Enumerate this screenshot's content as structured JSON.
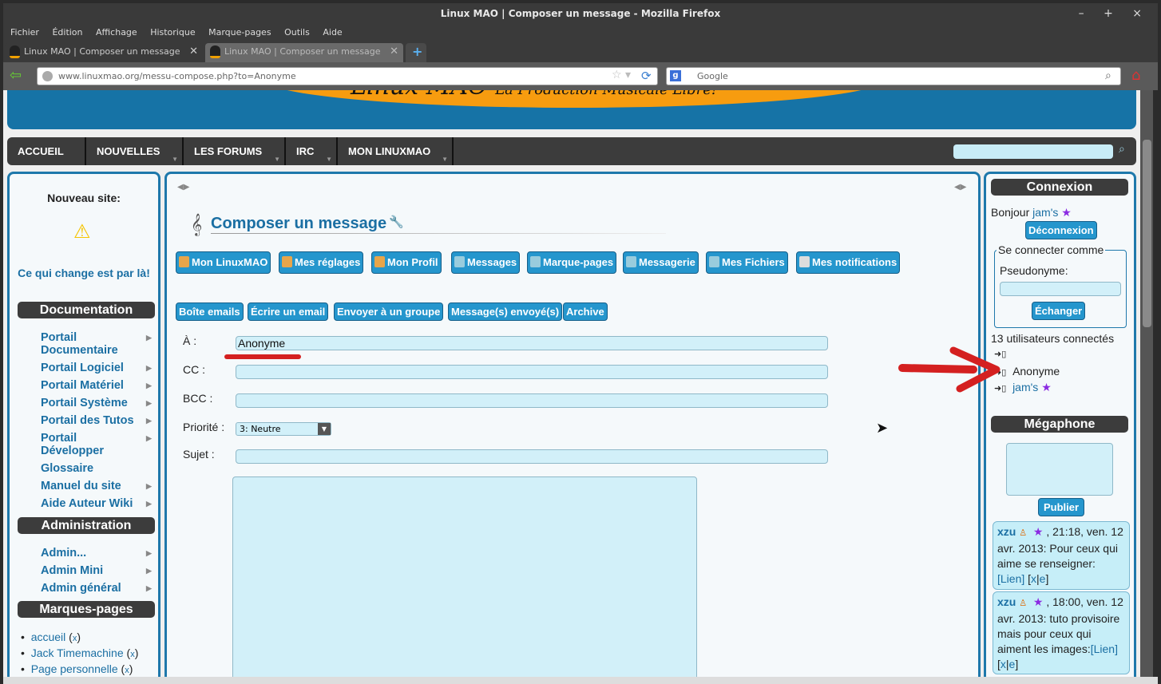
{
  "window": {
    "title": "Linux MAO | Composer un message - Mozilla Firefox",
    "controls": "– + ×"
  },
  "menubar": [
    "Fichier",
    "Édition",
    "Affichage",
    "Historique",
    "Marque-pages",
    "Outils",
    "Aide"
  ],
  "tabs": [
    {
      "label": "Linux MAO | Composer un message"
    },
    {
      "label": "Linux MAO | Composer un message"
    }
  ],
  "new_tab": "+",
  "address": {
    "url": "www.linuxmao.org/messu-compose.php?to=Anonyme"
  },
  "search": {
    "placeholder": "Google"
  },
  "site": {
    "logo": "Linux MAO",
    "tagline": "La Production Musicale Libre!",
    "menu": [
      "ACCUEIL",
      "NOUVELLES",
      "LES FORUMS",
      "IRC",
      "MON LINUXMAO"
    ]
  },
  "left": {
    "new_site": "Nouveau site:",
    "new_site_link": "Ce qui change est par là!",
    "doc_title": "Documentation",
    "doc_items": [
      "Portail Documentaire",
      "Portail Logiciel",
      "Portail Matériel",
      "Portail Système",
      "Portail des Tutos",
      "Portail Développer",
      "Glossaire",
      "Manuel du site",
      "Aide Auteur Wiki"
    ],
    "admin_title": "Administration",
    "admin_items": [
      "Admin...",
      "Admin Mini",
      "Admin général"
    ],
    "bm_title": "Marques-pages",
    "bookmarks": [
      "accueil",
      "Jack Timemachine",
      "Page personnelle"
    ],
    "bm_remove": "x"
  },
  "center": {
    "title": "Composer un message",
    "user_buttons": [
      "Mon LinuxMAO",
      "Mes réglages",
      "Mon Profil",
      "Messages",
      "Marque-pages",
      "Messagerie",
      "Mes Fichiers",
      "Mes notifications"
    ],
    "mail_buttons": [
      "Boîte emails",
      "Écrire un email",
      "Envoyer à un groupe",
      "Message(s) envoyé(s)",
      "Archive"
    ],
    "to_label": "À :",
    "to_value": "Anonyme",
    "cc_label": "CC :",
    "bcc_label": "BCC :",
    "priority_label": "Priorité :",
    "priority_value": "3: Neutre",
    "subject_label": "Sujet :"
  },
  "right": {
    "connexion_title": "Connexion",
    "hello": "Bonjour",
    "user": "jam's",
    "logout": "Déconnexion",
    "connect_as": "Se connecter comme",
    "pseudo_label": "Pseudonyme:",
    "swap": "Échanger",
    "users_count": "13 utilisateurs connectés",
    "users": [
      "",
      "Anonyme",
      "jam's"
    ],
    "megaphone_title": "Mégaphone",
    "publish": "Publier",
    "messages": [
      {
        "author": "xzu",
        "text": ", 21:18, ven. 12 avr. 2013: Pour ceux qui aime se renseigner:",
        "link": "[Lien]",
        "actions_open": "[",
        "x": "x",
        "sep": "|",
        "e": "e",
        "actions_close": "]"
      },
      {
        "author": "xzu",
        "text": ", 18:00, ven. 12 avr. 2013: tuto provisoire mais pour ceux qui aiment les images:",
        "link": "[Lien]",
        "actions_open": "[",
        "x": "x",
        "sep": "|",
        "e": "e",
        "actions_close": "]"
      }
    ]
  }
}
